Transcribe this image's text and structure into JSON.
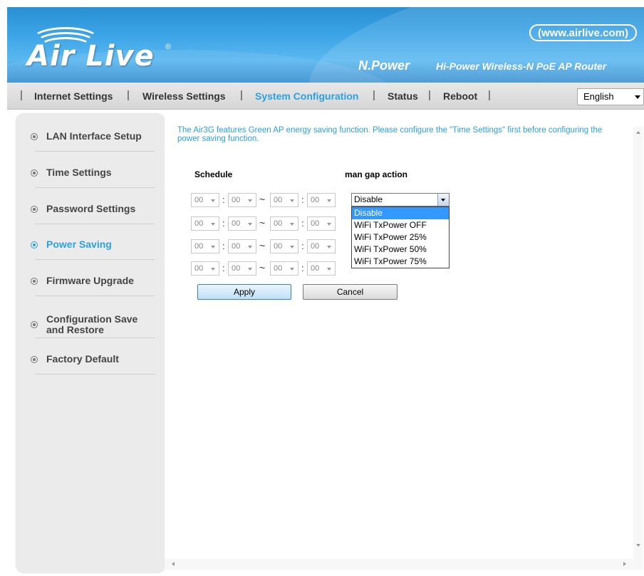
{
  "header": {
    "logo_text": "Air Live",
    "logo_reg": "®",
    "url": "(www.airlive.com)",
    "series": "N.Power",
    "product": "Hi-Power Wireless-N PoE AP Router"
  },
  "nav": {
    "items": [
      "Internet Settings",
      "Wireless Settings",
      "System Configuration",
      "Status",
      "Reboot"
    ],
    "active_index": 2,
    "separator": "|",
    "language": "English"
  },
  "sidebar": {
    "items": [
      {
        "label": "LAN Interface Setup"
      },
      {
        "label": "Time Settings"
      },
      {
        "label": "Password Settings"
      },
      {
        "label": "Power Saving"
      },
      {
        "label": "Firmware Upgrade"
      },
      {
        "label": "Configuration Save and Restore"
      },
      {
        "label": "Factory Default"
      }
    ],
    "active_index": 3
  },
  "main": {
    "intro": "The Air3G features Green AP energy saving function. Please configure the \"Time Settings\" first before configuring the power saving function.",
    "schedule_header": "Schedule",
    "action_header": "man gap action",
    "schedule_rows": [
      {
        "start_h": "00",
        "start_m": "00",
        "end_h": "00",
        "end_m": "00"
      },
      {
        "start_h": "00",
        "start_m": "00",
        "end_h": "00",
        "end_m": "00"
      },
      {
        "start_h": "00",
        "start_m": "00",
        "end_h": "00",
        "end_m": "00"
      },
      {
        "start_h": "00",
        "start_m": "00",
        "end_h": "00",
        "end_m": "00"
      }
    ],
    "colon": ":",
    "tilde": "~",
    "action_selected": "Disable",
    "action_options": [
      "Disable",
      "WiFi TxPower OFF",
      "WiFi TxPower 25%",
      "WiFi TxPower 50%",
      "WiFi TxPower 75%"
    ],
    "apply_label": "Apply",
    "cancel_label": "Cancel"
  },
  "colors": {
    "accent": "#2aa1e2",
    "highlight": "#3399ff",
    "header_blue": "#3aa3e6"
  }
}
